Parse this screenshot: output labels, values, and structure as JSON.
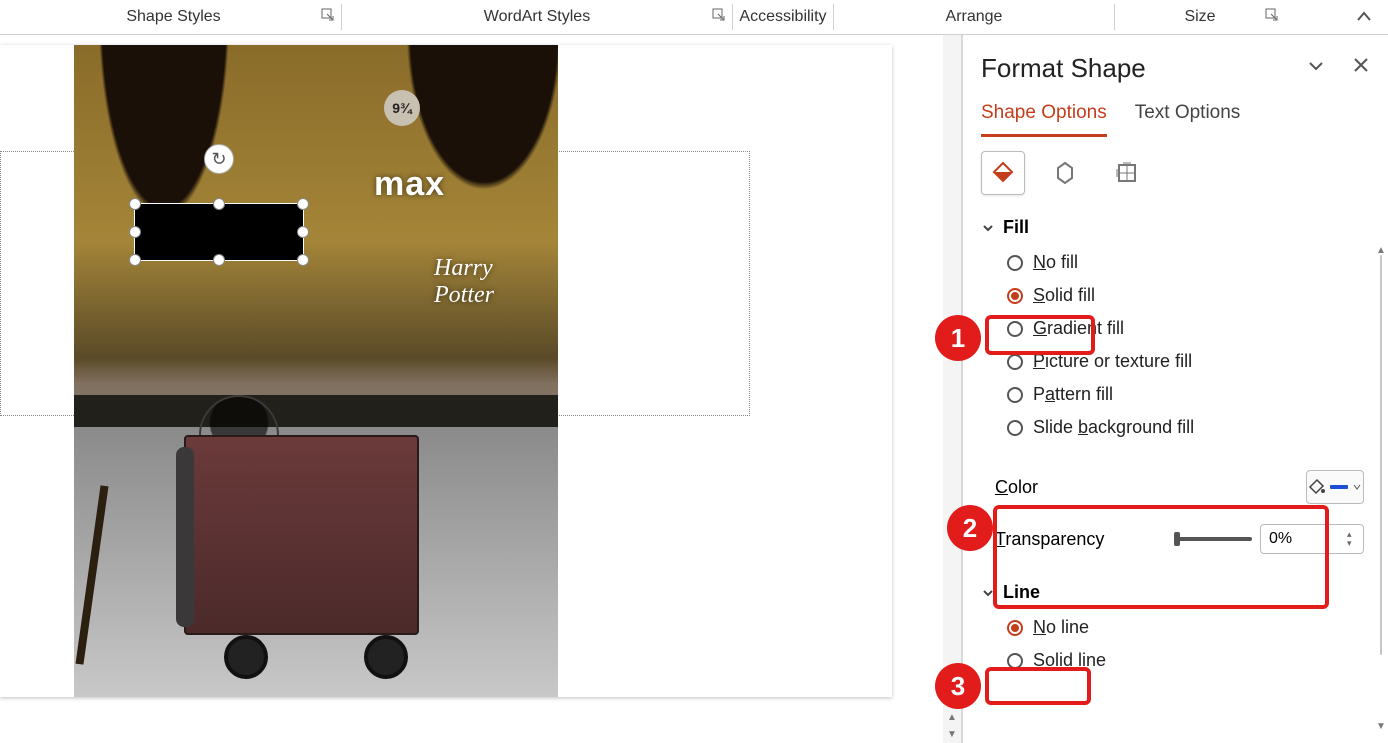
{
  "ribbon": {
    "groups": {
      "shape_styles": "Shape Styles",
      "wordart_styles": "WordArt Styles",
      "accessibility": "Accessibility",
      "arrange": "Arrange",
      "size": "Size"
    }
  },
  "slide": {
    "photo": {
      "sign_text": "9¾",
      "brand": "max",
      "title_curvy": "Harry Potter"
    }
  },
  "panel": {
    "title": "Format Shape",
    "tabs": {
      "shape_options": "Shape Options",
      "text_options": "Text Options"
    },
    "sections": {
      "fill": {
        "label": "Fill",
        "options": {
          "no_fill": "No fill",
          "solid_fill": "Solid fill",
          "gradient_fill": "Gradient fill",
          "picture_fill": "Picture or texture fill",
          "pattern_fill": "Pattern fill",
          "slide_bg_fill": "Slide background fill"
        },
        "color_label": "Color",
        "transparency_label": "Transparency",
        "transparency_value": "0%"
      },
      "line": {
        "label": "Line",
        "options": {
          "no_line": "No line",
          "solid_line": "Solid line"
        }
      }
    }
  },
  "annotations": {
    "n1": "1",
    "n2": "2",
    "n3": "3"
  }
}
